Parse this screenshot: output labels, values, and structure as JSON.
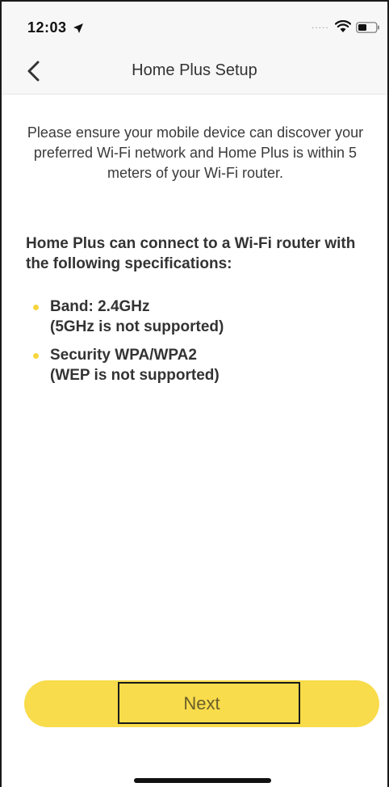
{
  "status_bar": {
    "time": "12:03",
    "signal_dots": ".....",
    "icons": [
      "location-arrow-icon",
      "wifi-icon",
      "battery-icon"
    ]
  },
  "nav": {
    "back_icon": "chevron-left-icon",
    "title": "Home Plus Setup"
  },
  "intro": {
    "text": "Please ensure your mobile device can discover your preferred Wi-Fi network and Home Plus is within 5 meters of your Wi-Fi router."
  },
  "specs": {
    "heading": "Home Plus can connect to a Wi-Fi router with the following specifications:",
    "items": [
      {
        "line1": "Band: 2.4GHz",
        "line2": "(5GHz is not supported)"
      },
      {
        "line1": "Security WPA/WPA2",
        "line2": "(WEP is not supported)"
      }
    ]
  },
  "actions": {
    "next_label": "Next"
  },
  "colors": {
    "accent": "#f8dc4b",
    "bullet": "#f5d63d",
    "bar_background": "#f7f7f7"
  }
}
